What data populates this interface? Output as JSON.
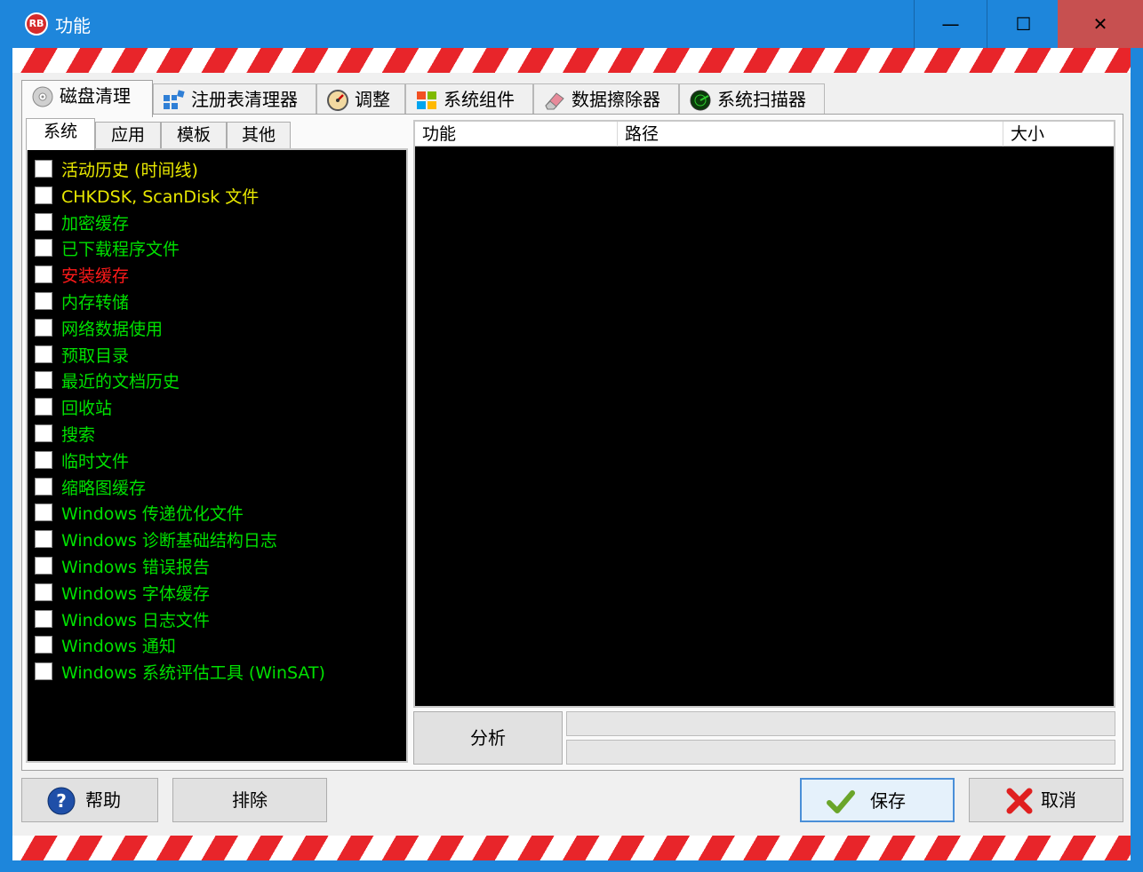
{
  "window": {
    "title": "功能",
    "app_icon": "RB",
    "minimize_glyph": "—",
    "maximize_glyph": "☐",
    "close_glyph": "✕"
  },
  "main_tabs": [
    {
      "label": "磁盘清理",
      "icon": "disk-icon"
    },
    {
      "label": "注册表清理器",
      "icon": "registry-icon"
    },
    {
      "label": "调整",
      "icon": "gauge-icon"
    },
    {
      "label": "系统组件",
      "icon": "windows-icon"
    },
    {
      "label": "数据擦除器",
      "icon": "eraser-icon"
    },
    {
      "label": "系统扫描器",
      "icon": "radar-icon"
    }
  ],
  "sub_tabs": [
    "系统",
    "应用",
    "模板",
    "其他"
  ],
  "items": [
    {
      "label": "活动历史 (时间线)",
      "color": "#e8e800"
    },
    {
      "label": "CHKDSK, ScanDisk 文件",
      "color": "#e8e800"
    },
    {
      "label": "加密缓存",
      "color": "#00e000"
    },
    {
      "label": "已下载程序文件",
      "color": "#00e000"
    },
    {
      "label": "安装缓存",
      "color": "#ff1a1a"
    },
    {
      "label": "内存转储",
      "color": "#00e000"
    },
    {
      "label": "网络数据使用",
      "color": "#00e000"
    },
    {
      "label": "预取目录",
      "color": "#00e000"
    },
    {
      "label": "最近的文档历史",
      "color": "#00e000"
    },
    {
      "label": "回收站",
      "color": "#00e000"
    },
    {
      "label": "搜索",
      "color": "#00e000"
    },
    {
      "label": "临时文件",
      "color": "#00e000"
    },
    {
      "label": "缩略图缓存",
      "color": "#00e000"
    },
    {
      "label": "Windows 传递优化文件",
      "color": "#00e000"
    },
    {
      "label": "Windows 诊断基础结构日志",
      "color": "#00e000"
    },
    {
      "label": "Windows 错误报告",
      "color": "#00e000"
    },
    {
      "label": "Windows 字体缓存",
      "color": "#00e000"
    },
    {
      "label": "Windows 日志文件",
      "color": "#00e000"
    },
    {
      "label": "Windows 通知",
      "color": "#00e000"
    },
    {
      "label": "Windows 系统评估工具 (WinSAT)",
      "color": "#00e000"
    }
  ],
  "table": {
    "columns": [
      "功能",
      "路径",
      "大小"
    ]
  },
  "analyze_label": "分析",
  "buttons": {
    "help": "帮助",
    "exclude": "排除",
    "save": "保存",
    "cancel": "取消"
  }
}
